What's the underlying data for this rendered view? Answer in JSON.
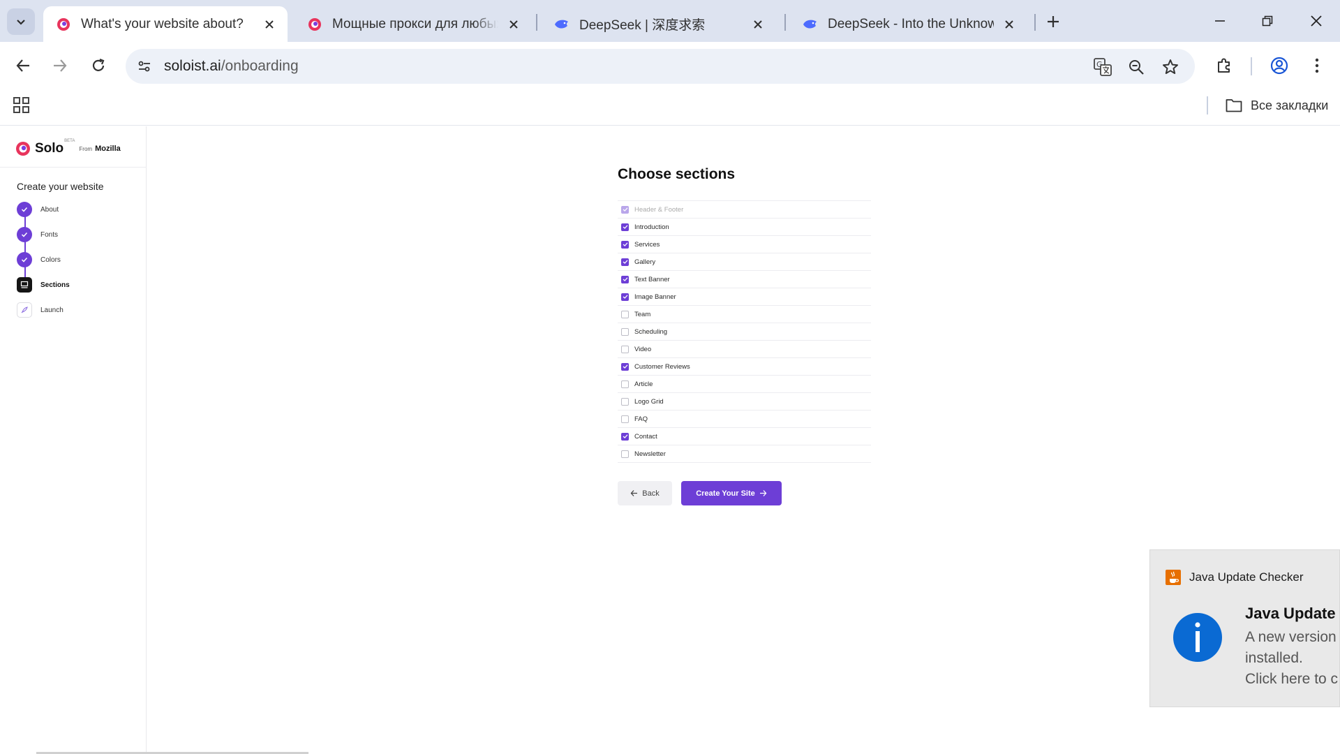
{
  "browser": {
    "tabs": [
      {
        "title": "What's your website about?",
        "active": true,
        "favicon": "solo-logo-icon"
      },
      {
        "title": "Мощные прокси для любых за",
        "active": false,
        "favicon": "solo-logo-icon"
      },
      {
        "title": "DeepSeek | 深度求索",
        "active": false,
        "favicon": "deepseek-whale-icon"
      },
      {
        "title": "DeepSeek - Into the Unknown",
        "active": false,
        "favicon": "deepseek-whale-icon"
      }
    ],
    "address": {
      "domain": "soloist.ai",
      "path": "/onboarding"
    },
    "bookmarks": {
      "all_label": "Все закладки"
    }
  },
  "sidebar": {
    "brand": {
      "name": "Solo",
      "beta": "BETA",
      "from": "From",
      "maker": "Mozilla"
    },
    "heading": "Create your website",
    "steps": [
      {
        "label": "About",
        "status": "done"
      },
      {
        "label": "Fonts",
        "status": "done"
      },
      {
        "label": "Colors",
        "status": "done"
      },
      {
        "label": "Sections",
        "status": "current"
      },
      {
        "label": "Launch",
        "status": "todo"
      }
    ]
  },
  "main": {
    "title": "Choose sections",
    "sections": [
      {
        "name": "Header & Footer",
        "checked": true,
        "disabled": true
      },
      {
        "name": "Introduction",
        "checked": true
      },
      {
        "name": "Services",
        "checked": true
      },
      {
        "name": "Gallery",
        "checked": true
      },
      {
        "name": "Text Banner",
        "checked": true
      },
      {
        "name": "Image Banner",
        "checked": true
      },
      {
        "name": "Team",
        "checked": false
      },
      {
        "name": "Scheduling",
        "checked": false
      },
      {
        "name": "Video",
        "checked": false
      },
      {
        "name": "Customer Reviews",
        "checked": true
      },
      {
        "name": "Article",
        "checked": false
      },
      {
        "name": "Logo Grid",
        "checked": false
      },
      {
        "name": "FAQ",
        "checked": false
      },
      {
        "name": "Contact",
        "checked": true
      },
      {
        "name": "Newsletter",
        "checked": false
      }
    ],
    "back_label": "Back",
    "create_label": "Create Your Site"
  },
  "notification": {
    "app": "Java Update Checker",
    "title": "Java Update A",
    "body": [
      "A new version",
      "installed.",
      "Click here to c"
    ]
  },
  "colors": {
    "accent": "#6d3ed6",
    "tabstrip": "#dde3f0",
    "java_info": "#0a6ad3"
  }
}
